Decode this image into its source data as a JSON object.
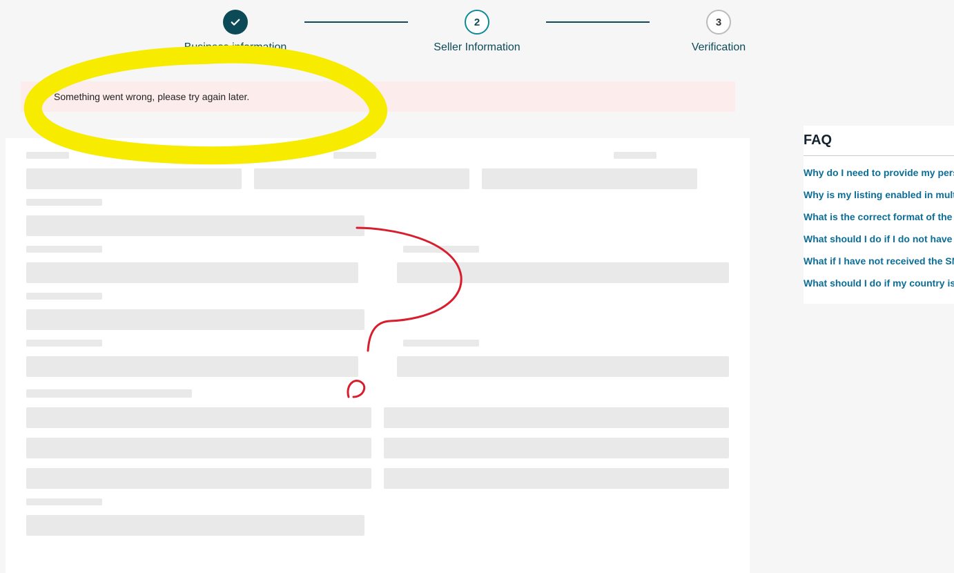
{
  "stepper": {
    "steps": [
      {
        "num": "",
        "label": "Business information",
        "state": "done"
      },
      {
        "num": "2",
        "label": "Seller Information",
        "state": "active"
      },
      {
        "num": "3",
        "label": "Verification",
        "state": "pending"
      }
    ]
  },
  "error": {
    "message": "Something went wrong, please try again later."
  },
  "faq": {
    "title": "FAQ",
    "links": [
      "Why do I need to provide my perso",
      "Why is my listing enabled in multi",
      "What is the correct format of the p",
      "What should I do if I do not have a",
      "What if I have not received the SMS",
      "What should I do if my country is n"
    ]
  }
}
